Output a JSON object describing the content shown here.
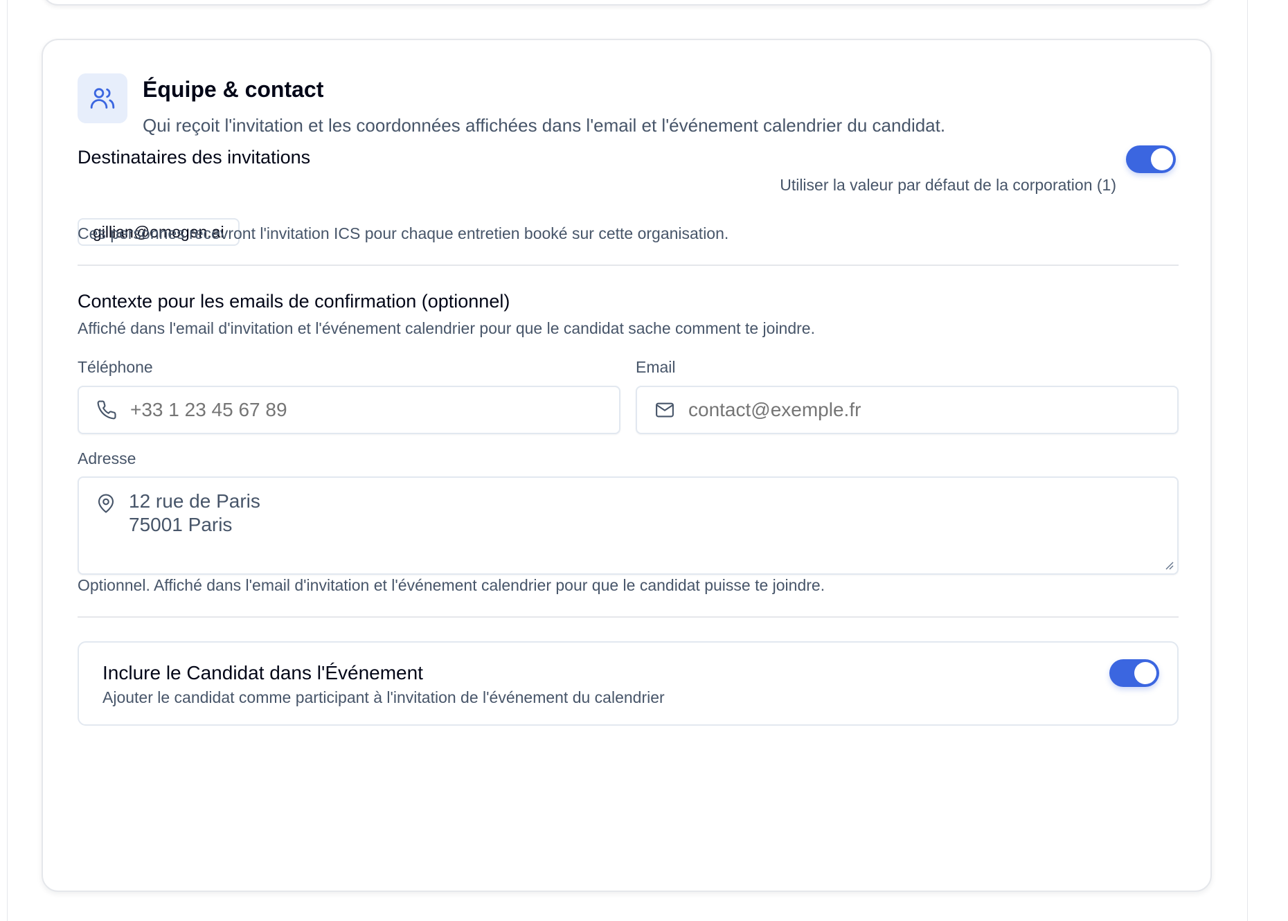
{
  "section": {
    "icon": "users-icon",
    "title": "Équipe & contact",
    "description": "Qui reçoit l'invitation et les coordonnées affichées dans l'email et l'événement calendrier du candidat."
  },
  "recipients": {
    "title": "Destinataires des invitations",
    "default_toggle_label": "Utiliser la valeur par défaut de la corporation (1)",
    "default_toggle_on": true,
    "chips": [
      "gillian@omogen.ai"
    ],
    "help": "Ces personnes recevront l'invitation ICS pour chaque entretien booké sur cette organisation."
  },
  "context": {
    "title": "Contexte pour les emails de confirmation (optionnel)",
    "description": "Affiché dans l'email d'invitation et l'événement calendrier pour que le candidat sache comment te joindre.",
    "phone": {
      "label": "Téléphone",
      "placeholder": "+33 1 23 45 67 89",
      "icon": "phone-icon"
    },
    "email": {
      "label": "Email",
      "placeholder": "contact@exemple.fr",
      "icon": "mail-icon"
    },
    "address": {
      "label": "Adresse",
      "placeholder_lines": [
        "12 rue de Paris",
        "75001 Paris"
      ],
      "icon": "map-pin-icon",
      "help": "Optionnel. Affiché dans l'email d'invitation et l'événement calendrier pour que le candidat puisse te joindre."
    }
  },
  "include_candidate": {
    "title": "Inclure le Candidat dans l'Événement",
    "description": "Ajouter le candidat comme participant à l'invitation de l'événement du calendrier",
    "toggle_on": true
  },
  "colors": {
    "accent": "#3b66e0",
    "icon_bg": "#e7eefb",
    "muted_text": "#475569",
    "border": "#e2e8f0"
  }
}
